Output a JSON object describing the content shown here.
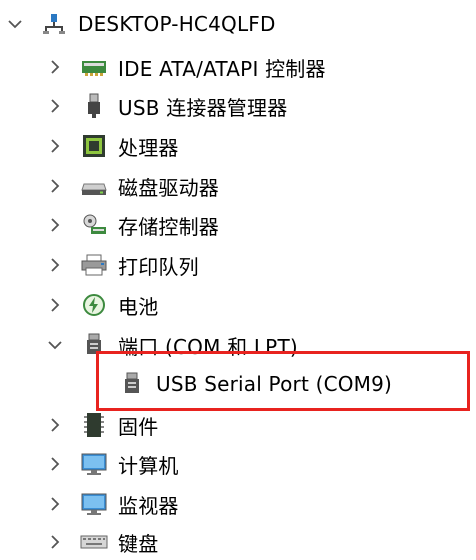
{
  "tree": {
    "root": {
      "label": "DESKTOP-HC4QLFD",
      "icon": "computer-network-icon",
      "expanded": true
    },
    "items": [
      {
        "label": "IDE ATA/ATAPI 控制器",
        "icon": "ide-controller-icon",
        "expanded": false
      },
      {
        "label": "USB 连接器管理器",
        "icon": "usb-connector-icon",
        "expanded": false
      },
      {
        "label": "处理器",
        "icon": "processor-icon",
        "expanded": false
      },
      {
        "label": "磁盘驱动器",
        "icon": "disk-drive-icon",
        "expanded": false
      },
      {
        "label": "存储控制器",
        "icon": "storage-controller-icon",
        "expanded": false
      },
      {
        "label": "打印队列",
        "icon": "printer-icon",
        "expanded": false
      },
      {
        "label": "电池",
        "icon": "battery-icon",
        "expanded": false
      },
      {
        "label": "端口 (COM 和 LPT)",
        "icon": "port-icon",
        "expanded": true
      },
      {
        "label": "USB Serial Port (COM9)",
        "icon": "serial-port-icon",
        "child": true
      },
      {
        "label": "固件",
        "icon": "firmware-icon",
        "expanded": false
      },
      {
        "label": "计算机",
        "icon": "computer-icon",
        "expanded": false
      },
      {
        "label": "监视器",
        "icon": "monitor-icon",
        "expanded": false
      },
      {
        "label": "键盘",
        "icon": "keyboard-icon",
        "expanded": false
      }
    ]
  },
  "colors": {
    "highlight_border": "#e8231f",
    "chevron": "#555555"
  }
}
